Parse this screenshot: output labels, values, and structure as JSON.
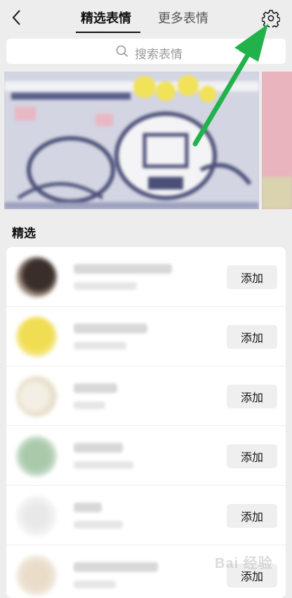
{
  "header": {
    "tabs": [
      {
        "label": "精选表情",
        "selected": true
      },
      {
        "label": "更多表情",
        "selected": false
      }
    ]
  },
  "search": {
    "placeholder": "搜索表情"
  },
  "section": {
    "title": "精选"
  },
  "list": {
    "items": [
      {
        "button": "添加"
      },
      {
        "button": "添加"
      },
      {
        "button": "添加"
      },
      {
        "button": "添加"
      },
      {
        "button": "添加"
      },
      {
        "button": "添加"
      }
    ]
  },
  "watermark": {
    "text": "Bai 经验"
  },
  "icons": {
    "back": "chevron-left-icon",
    "settings": "gear-icon",
    "search": "search-icon"
  },
  "colors": {
    "background": "#ededed",
    "annotation_arrow": "#22b24c",
    "tab_underline": "#111111"
  }
}
